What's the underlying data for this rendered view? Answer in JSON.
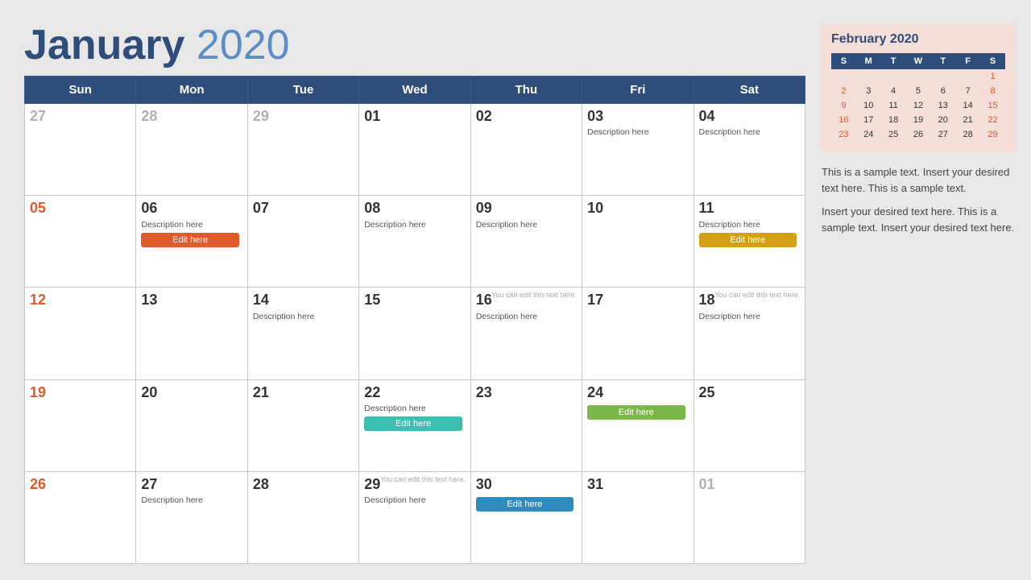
{
  "header": {
    "month": "January",
    "year": "2020"
  },
  "days_of_week": [
    "Sun",
    "Mon",
    "Tue",
    "Wed",
    "Thu",
    "Fri",
    "Sat"
  ],
  "weeks": [
    [
      {
        "num": "27",
        "active": false,
        "sunday": false
      },
      {
        "num": "28",
        "active": false,
        "sunday": false
      },
      {
        "num": "29",
        "active": false,
        "sunday": false
      },
      {
        "num": "01",
        "active": true,
        "sunday": false
      },
      {
        "num": "02",
        "active": true,
        "sunday": false
      },
      {
        "num": "03",
        "active": true,
        "sunday": false,
        "desc": "Description here"
      },
      {
        "num": "04",
        "active": true,
        "sunday": false,
        "desc": "Description here"
      }
    ],
    [
      {
        "num": "05",
        "active": true,
        "sunday": true
      },
      {
        "num": "06",
        "active": true,
        "sunday": false,
        "desc": "Description here",
        "btn": "Edit here",
        "btnColor": "orange"
      },
      {
        "num": "07",
        "active": true,
        "sunday": false
      },
      {
        "num": "08",
        "active": true,
        "sunday": false,
        "desc": "Description here"
      },
      {
        "num": "09",
        "active": true,
        "sunday": false,
        "desc": "Description here"
      },
      {
        "num": "10",
        "active": true,
        "sunday": false
      },
      {
        "num": "11",
        "active": true,
        "sunday": false,
        "desc": "Description here",
        "btn": "Edit here",
        "btnColor": "yellow"
      }
    ],
    [
      {
        "num": "12",
        "active": true,
        "sunday": true
      },
      {
        "num": "13",
        "active": true,
        "sunday": false
      },
      {
        "num": "14",
        "active": true,
        "sunday": false,
        "desc": "Description here"
      },
      {
        "num": "15",
        "active": true,
        "sunday": false
      },
      {
        "num": "16",
        "active": true,
        "sunday": false,
        "hint": "You can edit this text here.",
        "desc": "Description here"
      },
      {
        "num": "17",
        "active": true,
        "sunday": false
      },
      {
        "num": "18",
        "active": true,
        "sunday": false,
        "hint": "You can edit this text here.",
        "desc": "Description here"
      }
    ],
    [
      {
        "num": "19",
        "active": true,
        "sunday": true
      },
      {
        "num": "20",
        "active": true,
        "sunday": false
      },
      {
        "num": "21",
        "active": true,
        "sunday": false
      },
      {
        "num": "22",
        "active": true,
        "sunday": false,
        "desc": "Description here",
        "btn": "Edit here",
        "btnColor": "teal"
      },
      {
        "num": "23",
        "active": true,
        "sunday": false
      },
      {
        "num": "24",
        "active": true,
        "sunday": false,
        "btn": "Edit here",
        "btnColor": "green"
      },
      {
        "num": "25",
        "active": true,
        "sunday": false
      }
    ],
    [
      {
        "num": "26",
        "active": true,
        "sunday": true
      },
      {
        "num": "27",
        "active": true,
        "sunday": false,
        "desc": "Description here"
      },
      {
        "num": "28",
        "active": true,
        "sunday": false
      },
      {
        "num": "29",
        "active": true,
        "sunday": false,
        "hint": "You can edit this text here.",
        "desc": "Description here"
      },
      {
        "num": "30",
        "active": true,
        "sunday": false,
        "btn": "Edit here",
        "btnColor": "blue"
      },
      {
        "num": "31",
        "active": true,
        "sunday": false
      },
      {
        "num": "01",
        "active": false,
        "sunday": false
      }
    ]
  ],
  "sidebar": {
    "mini_title": "February 2020",
    "mini_days": [
      "S",
      "M",
      "T",
      "W",
      "T",
      "F",
      "S"
    ],
    "mini_weeks": [
      [
        "",
        "",
        "",
        "",
        "",
        "",
        "1"
      ],
      [
        "2",
        "3",
        "4",
        "5",
        "6",
        "7",
        "8"
      ],
      [
        "9",
        "10",
        "11",
        "12",
        "13",
        "14",
        "15"
      ],
      [
        "16",
        "17",
        "18",
        "19",
        "20",
        "21",
        "22"
      ],
      [
        "23",
        "24",
        "25",
        "26",
        "27",
        "28",
        "29"
      ]
    ],
    "text1": "This is a sample text. Insert your desired text here. This is a sample text.",
    "text2": "Insert your desired text here. This is a sample text. Insert your desired text here."
  }
}
